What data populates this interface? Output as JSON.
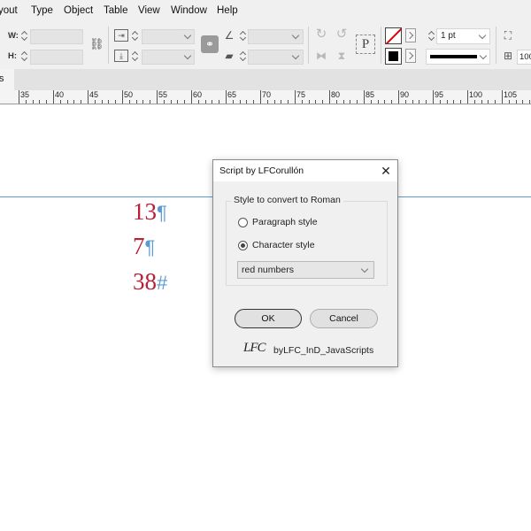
{
  "menu": [
    "yout",
    "Type",
    "Object",
    "Table",
    "View",
    "Window",
    "Help"
  ],
  "control": {
    "w_label": "W:",
    "h_label": "H:",
    "stroke_weight": "1 pt",
    "pct": "100",
    "p_icon_label": "P"
  },
  "tab": {
    "close": "s"
  },
  "ruler": {
    "labels": [
      "35",
      "40",
      "45",
      "50",
      "55",
      "60",
      "65",
      "70",
      "75",
      "80",
      "85",
      "90",
      "95",
      "100",
      "105"
    ]
  },
  "document": {
    "numbers": [
      {
        "digits": "13",
        "mark": "¶"
      },
      {
        "digits": "7",
        "mark": "¶"
      },
      {
        "digits": "38",
        "mark": "#"
      }
    ],
    "colors": {
      "number": "#b82038",
      "hidden_char": "#5b9bd5",
      "guide": "#5b9bd5"
    }
  },
  "dialog": {
    "title": "Script by LFCorullón",
    "group_label": "Style to convert to Roman",
    "options": [
      "Paragraph style",
      "Character style"
    ],
    "selected_option": "Character style",
    "style_value": "red numbers",
    "ok_label": "OK",
    "cancel_label": "Cancel",
    "logo_text": "LFC",
    "credit": "byLFC_InD_JavaScripts"
  }
}
